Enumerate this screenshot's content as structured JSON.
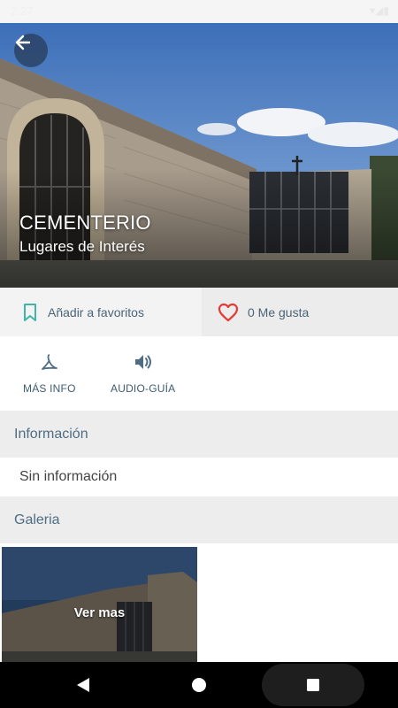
{
  "status_bar": {
    "time": "2:27",
    "right_icons": "▾◢▮"
  },
  "place": {
    "title": "CEMENTERIO",
    "category": "Lugares de Interés"
  },
  "actions": {
    "favorites_label": "Añadir a favoritos",
    "likes_label": "0 Me gusta"
  },
  "tools": {
    "more_info_label": "MÁS INFO",
    "audio_guide_label": "AUDIO-GUÍA"
  },
  "sections": {
    "info_header": "Información",
    "info_text": "Sin información",
    "gallery_header": "Galeria"
  },
  "gallery": {
    "see_more_label": "Ver mas"
  },
  "colors": {
    "accent_teal": "#3fb5a8",
    "like_red": "#e53935",
    "section_text": "#4e6d84"
  }
}
